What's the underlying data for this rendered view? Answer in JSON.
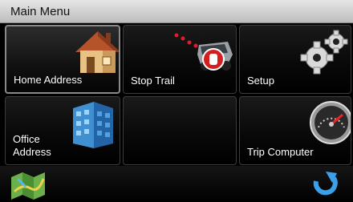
{
  "title": "Main Menu",
  "tiles": [
    {
      "label": "Home Address",
      "icon": "house-icon"
    },
    {
      "label": "Stop Trail",
      "icon": "stop-trail-icon"
    },
    {
      "label": "Setup",
      "icon": "gears-icon"
    },
    {
      "label": "Office Address",
      "icon": "office-building-icon"
    },
    {
      "label": "",
      "icon": ""
    },
    {
      "label": "Trip Computer",
      "icon": "speedometer-icon"
    }
  ],
  "bottom": {
    "left_icon": "map-icon",
    "right_icon": "back-arrow-icon"
  }
}
